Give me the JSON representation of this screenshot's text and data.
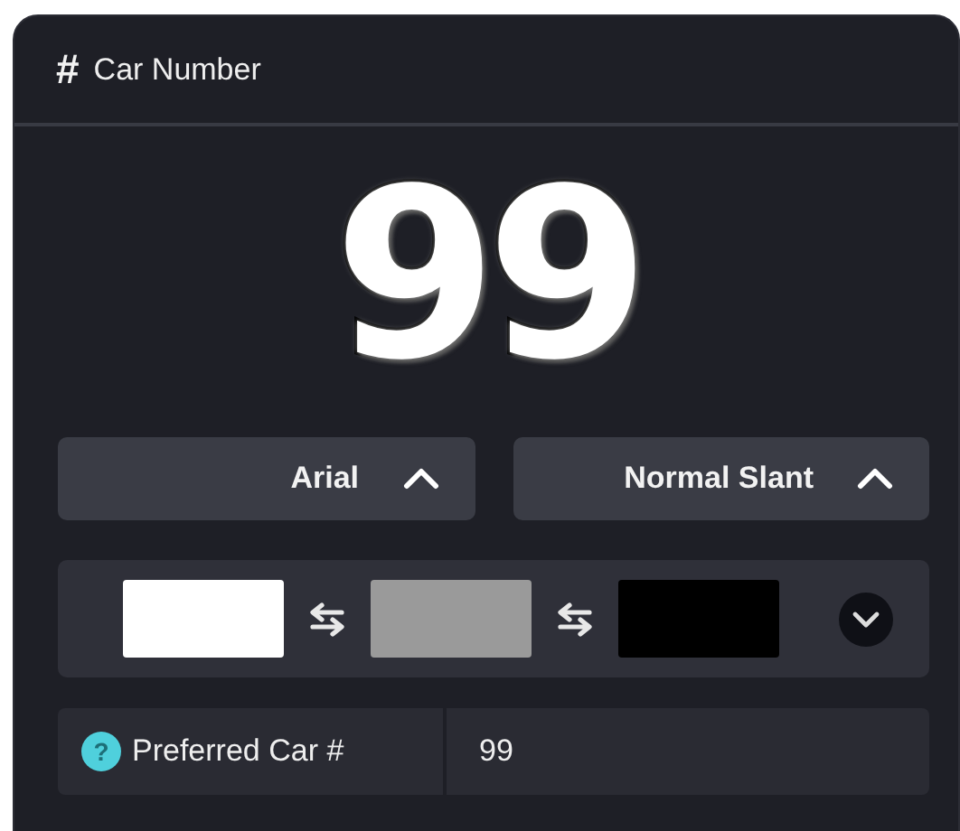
{
  "header": {
    "icon_text": "#",
    "title": "Car Number"
  },
  "preview": "99",
  "dropdowns": [
    {
      "label": "Arial",
      "expanded": true
    },
    {
      "label": "Normal Slant",
      "expanded": true
    }
  ],
  "color_swatches": [
    {
      "color": "#ffffff"
    },
    {
      "color": "#9a9a9a"
    },
    {
      "color": "#000000"
    }
  ],
  "preferred": {
    "help_icon_text": "?",
    "label": "Preferred Car #",
    "value": "99"
  }
}
